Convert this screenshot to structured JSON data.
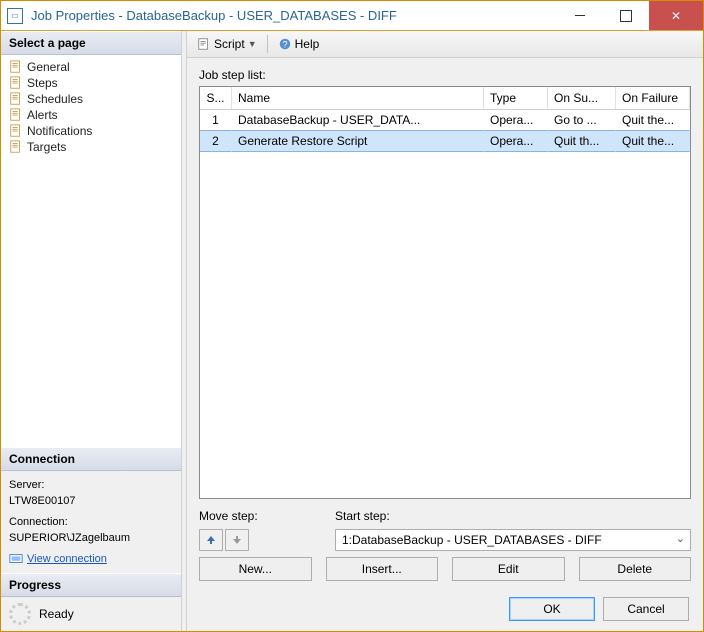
{
  "window": {
    "title": "Job Properties - DatabaseBackup - USER_DATABASES - DIFF"
  },
  "sidebar": {
    "select_label": "Select a page",
    "items": [
      {
        "label": "General"
      },
      {
        "label": "Steps"
      },
      {
        "label": "Schedules"
      },
      {
        "label": "Alerts"
      },
      {
        "label": "Notifications"
      },
      {
        "label": "Targets"
      }
    ],
    "connection": {
      "header": "Connection",
      "server_label": "Server:",
      "server_value": "LTW8E00107",
      "conn_label": "Connection:",
      "conn_value": "SUPERIOR\\JZagelbaum",
      "view_link": "View connection "
    },
    "progress": {
      "header": "Progress",
      "status": "Ready"
    }
  },
  "toolbar": {
    "script_label": "Script",
    "help_label": "Help"
  },
  "steps": {
    "list_label": "Job step list:",
    "columns": {
      "s": "S...",
      "name": "Name",
      "type": "Type",
      "onsuccess": "On Su...",
      "onfailure": "On Failure"
    },
    "rows": [
      {
        "s": "1",
        "name": "DatabaseBackup - USER_DATA...",
        "type": "Opera...",
        "onsuccess": "Go to ...",
        "onfailure": "Quit the..."
      },
      {
        "s": "2",
        "name": "Generate Restore Script",
        "type": "Opera...",
        "onsuccess": "Quit th...",
        "onfailure": "Quit the..."
      }
    ],
    "selected_index": 1,
    "move_label": "Move step:",
    "start_label": "Start step:",
    "start_value": "1:DatabaseBackup - USER_DATABASES - DIFF",
    "buttons": {
      "new": "New...",
      "insert": "Insert...",
      "edit": "Edit",
      "delete": "Delete"
    }
  },
  "dialog": {
    "ok": "OK",
    "cancel": "Cancel"
  }
}
